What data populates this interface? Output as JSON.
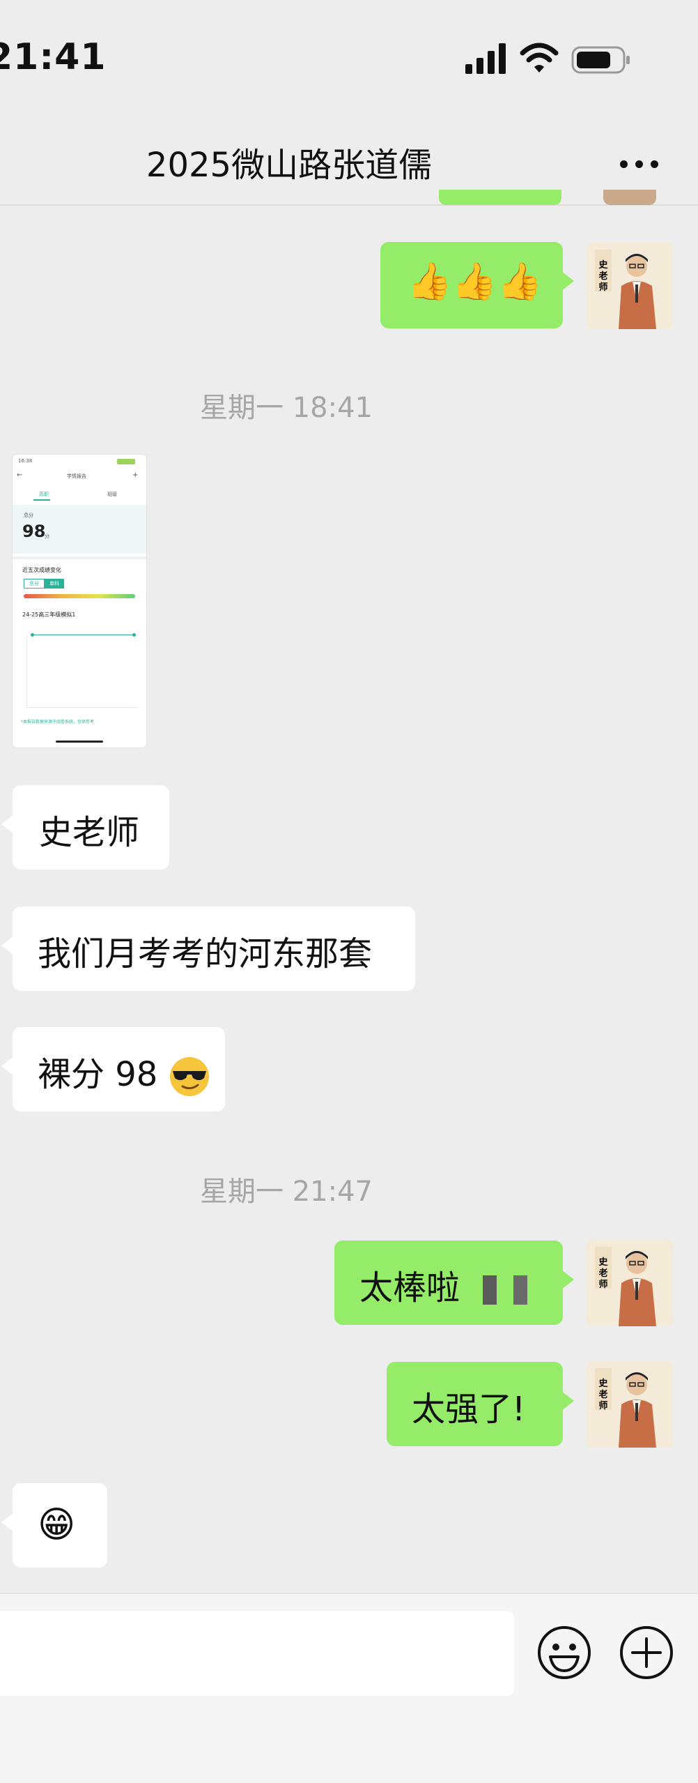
{
  "status_bar": {
    "time": "21:41"
  },
  "header": {
    "title": "2025微山路张道儒"
  },
  "messages": {
    "thumbs": "👍👍👍",
    "timestamp1": "星期一 18:41",
    "image_preview": {
      "time": "16:38",
      "title": "学情报告",
      "tab1": "高职",
      "tab2": "班级",
      "score_label": "总分",
      "score": "98",
      "score_suffix": "分",
      "section": "近五次成绩变化",
      "chip1": "总分",
      "chip2": "单科",
      "subtitle": "24-25高三年级模拟1",
      "footer": "*本报告数据来源于阅卷系统，仅供参考"
    },
    "m1": "史老师",
    "m2": "我们月考考的河东那套",
    "m3": "裸分 98",
    "timestamp2": "星期一 21:47",
    "m4": "太棒啦",
    "m5": "太强了!",
    "m6": "😁",
    "avatar_label": "史老师"
  }
}
